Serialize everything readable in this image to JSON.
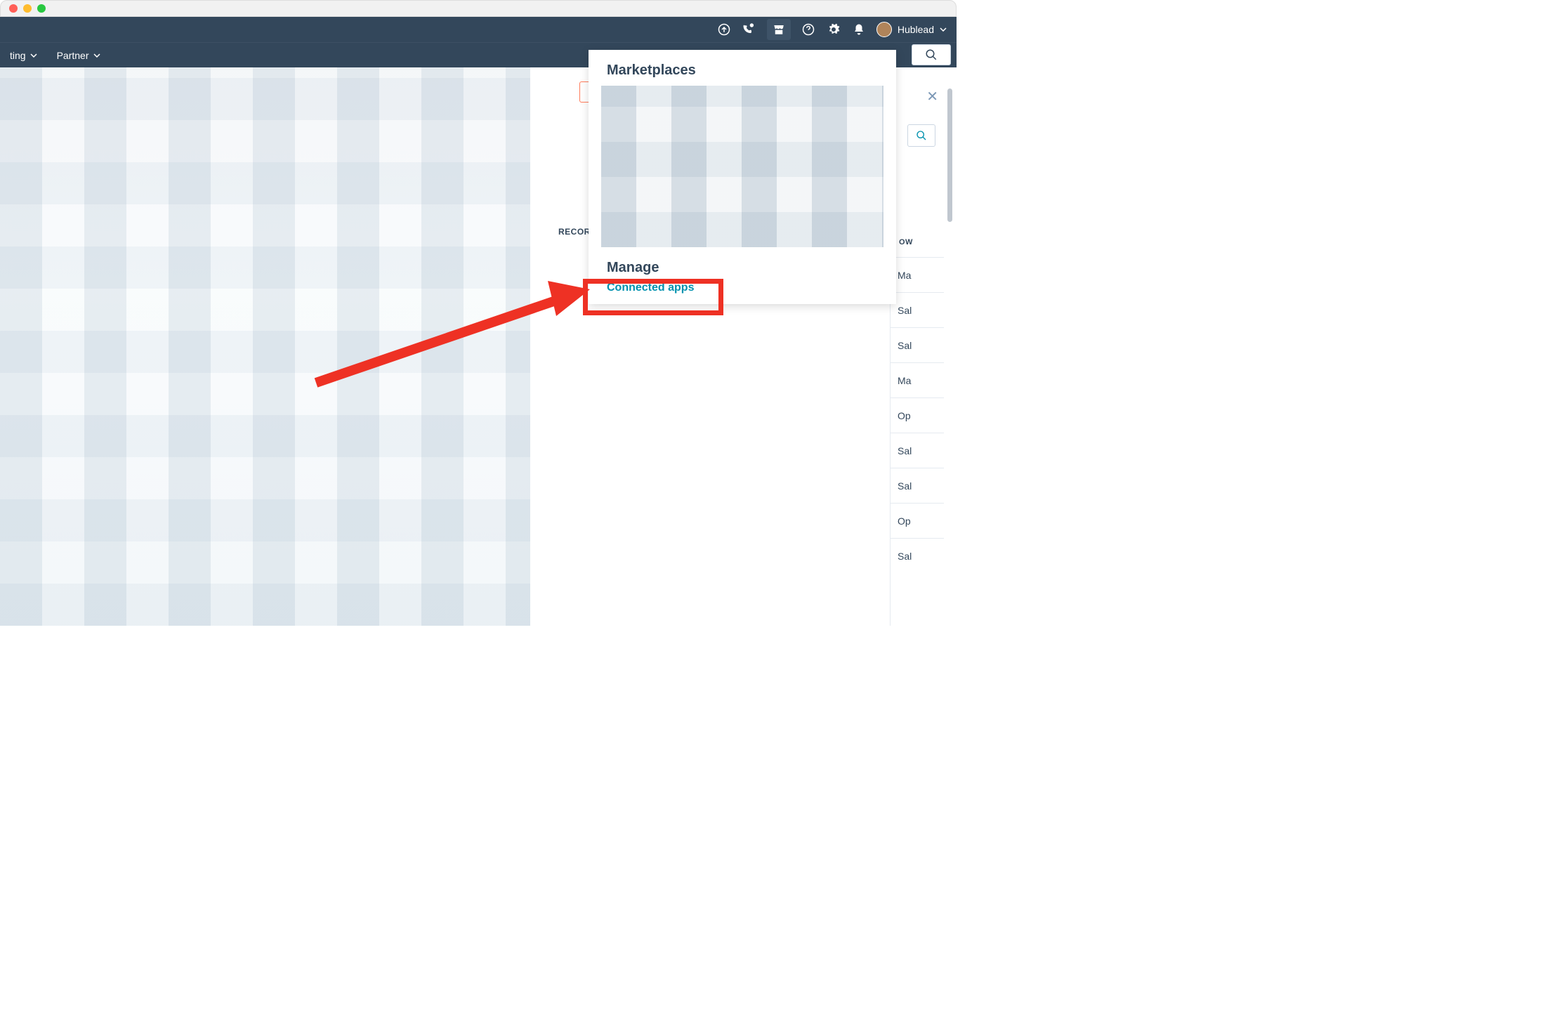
{
  "topbar": {
    "account_name": "Hublead"
  },
  "nav": {
    "item_reporting_partial": "ting",
    "item_partner": "Partner"
  },
  "dropdown": {
    "marketplaces_title": "Marketplaces",
    "manage_title": "Manage",
    "connected_apps": "Connected apps"
  },
  "mid": {
    "record_partial": "RECOR"
  },
  "right_panel": {
    "header_partial": "OW",
    "rows": [
      "Ma",
      "Sal",
      "Sal",
      "Ma",
      "Op",
      "Sal",
      "Sal",
      "Op",
      "Sal"
    ]
  }
}
